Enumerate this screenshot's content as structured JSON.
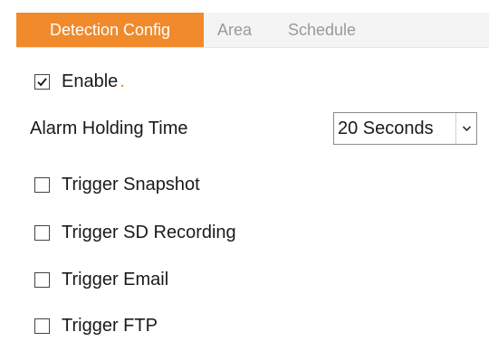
{
  "tabs": [
    {
      "label": "Detection Config",
      "active": true
    },
    {
      "label": "Area",
      "active": false
    },
    {
      "label": "Schedule",
      "active": false
    }
  ],
  "enable": {
    "label": "Enable",
    "suffix": ".",
    "checked": true
  },
  "alarm_holding_time": {
    "label": "Alarm Holding Time",
    "selected": "20 Seconds"
  },
  "triggers": [
    {
      "label": "Trigger Snapshot",
      "checked": false
    },
    {
      "label": "Trigger SD Recording",
      "checked": false
    },
    {
      "label": "Trigger Email",
      "checked": false
    },
    {
      "label": "Trigger FTP",
      "checked": false
    }
  ],
  "colors": {
    "active_tab": "#f08a2b",
    "inactive_tab_text": "#9a9a9a",
    "tabbar_background": "#f4f4f4"
  },
  "icons": {
    "checkmark": "check-icon",
    "dropdown": "chevron-down-icon"
  }
}
